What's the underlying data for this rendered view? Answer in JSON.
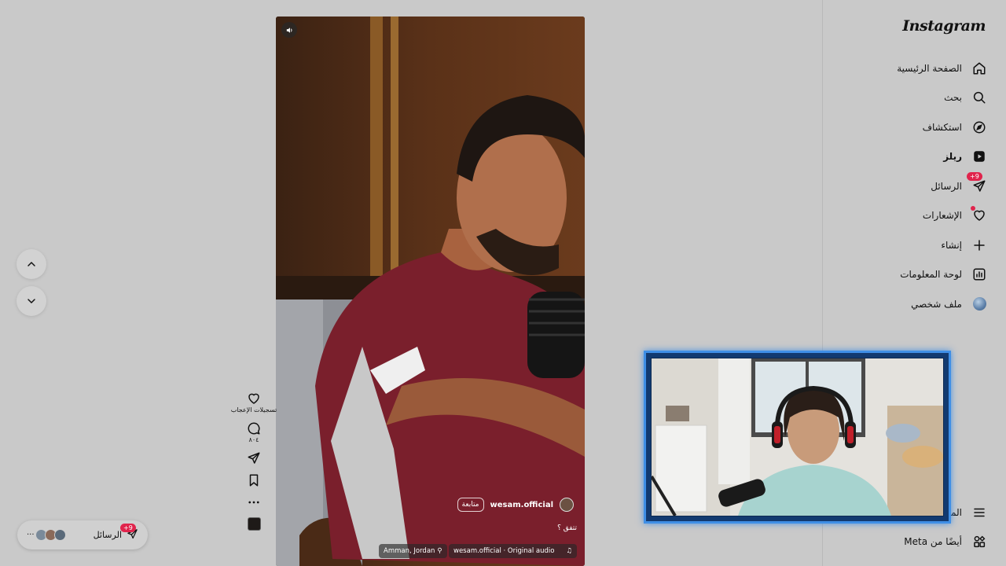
{
  "sidebar": {
    "logo": "Instagram",
    "items": [
      {
        "label": "الصفحة الرئيسية",
        "icon": "home-icon"
      },
      {
        "label": "بحث",
        "icon": "search-icon"
      },
      {
        "label": "استكشاف",
        "icon": "compass-icon"
      },
      {
        "label": "ريلز",
        "icon": "reels-icon",
        "active": true
      },
      {
        "label": "الرسائل",
        "icon": "messages-icon",
        "badge": "+9"
      },
      {
        "label": "الإشعارات",
        "icon": "heart-icon"
      },
      {
        "label": "إنشاء",
        "icon": "plus-icon"
      },
      {
        "label": "لوحة المعلومات",
        "icon": "dashboard-icon"
      },
      {
        "label": "ملف شخصي",
        "icon": "profile-avatar"
      }
    ],
    "bottom": [
      {
        "label": "المزيد",
        "icon": "menu-icon"
      },
      {
        "label": "أيضًا من Meta",
        "icon": "meta-apps-icon"
      }
    ]
  },
  "reel": {
    "username": "wesam.official",
    "follow_label": "متابعة",
    "caption": "تتفق ؟",
    "location": "Amman, Jordan",
    "audio": "wesam.official · Original audio"
  },
  "actions": {
    "likes_label": "تسجيلات الإعجاب",
    "comments_count": "٨٠٤"
  },
  "messages_pill": {
    "label": "الرسائل",
    "badge": "+9",
    "more": "···"
  },
  "colors": {
    "background": "#c9c9c9",
    "badge": "#e0244c",
    "webcam_border": "#3f8fe6"
  }
}
